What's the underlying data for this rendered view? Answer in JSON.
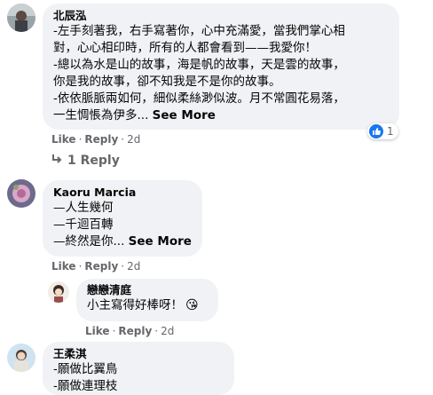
{
  "comments": [
    {
      "author": "北辰泓",
      "lines": [
        "-左手刻著我，右手寫著你，心中充滿愛，當我們掌心相",
        "對，心心相印時，所有的人都會看到——我愛你！",
        "-總以為水是山的故事，海是帆的故事，天是雲的故事，",
        "你是我的故事，卻不知我是不是你的故事。",
        "-依依脈脈兩如何，細似柔絲渺似波。月不常圓花易落，",
        "一生惆悵為伊多..."
      ],
      "see_more": "See More",
      "reaction_count": "1",
      "actions": {
        "like": "Like",
        "reply": "Reply",
        "time": "2d"
      },
      "replies_link": "1 Reply"
    },
    {
      "author": "Kaoru Marcia",
      "lines": [
        "—人生幾何",
        "—千迴百轉",
        "—終然是你..."
      ],
      "see_more": "See More",
      "actions": {
        "like": "Like",
        "reply": "Reply",
        "time": "2d"
      }
    },
    {
      "author": "戀戀清庭",
      "lines": [
        "小主寫得好棒呀！"
      ],
      "emoji": "😘",
      "actions": {
        "like": "Like",
        "reply": "Reply",
        "time": "2d"
      }
    },
    {
      "author": "王柔淇",
      "lines": [
        "-願做比翼鳥",
        "-願做連理枝"
      ]
    }
  ],
  "icons": {
    "reply_arrow": "reply-arrow-icon",
    "like_reaction": "like-reaction-icon"
  },
  "colors": {
    "bubble": "#f0f2f5",
    "secondary_text": "#65676b",
    "like_blue": "#1877f2"
  }
}
